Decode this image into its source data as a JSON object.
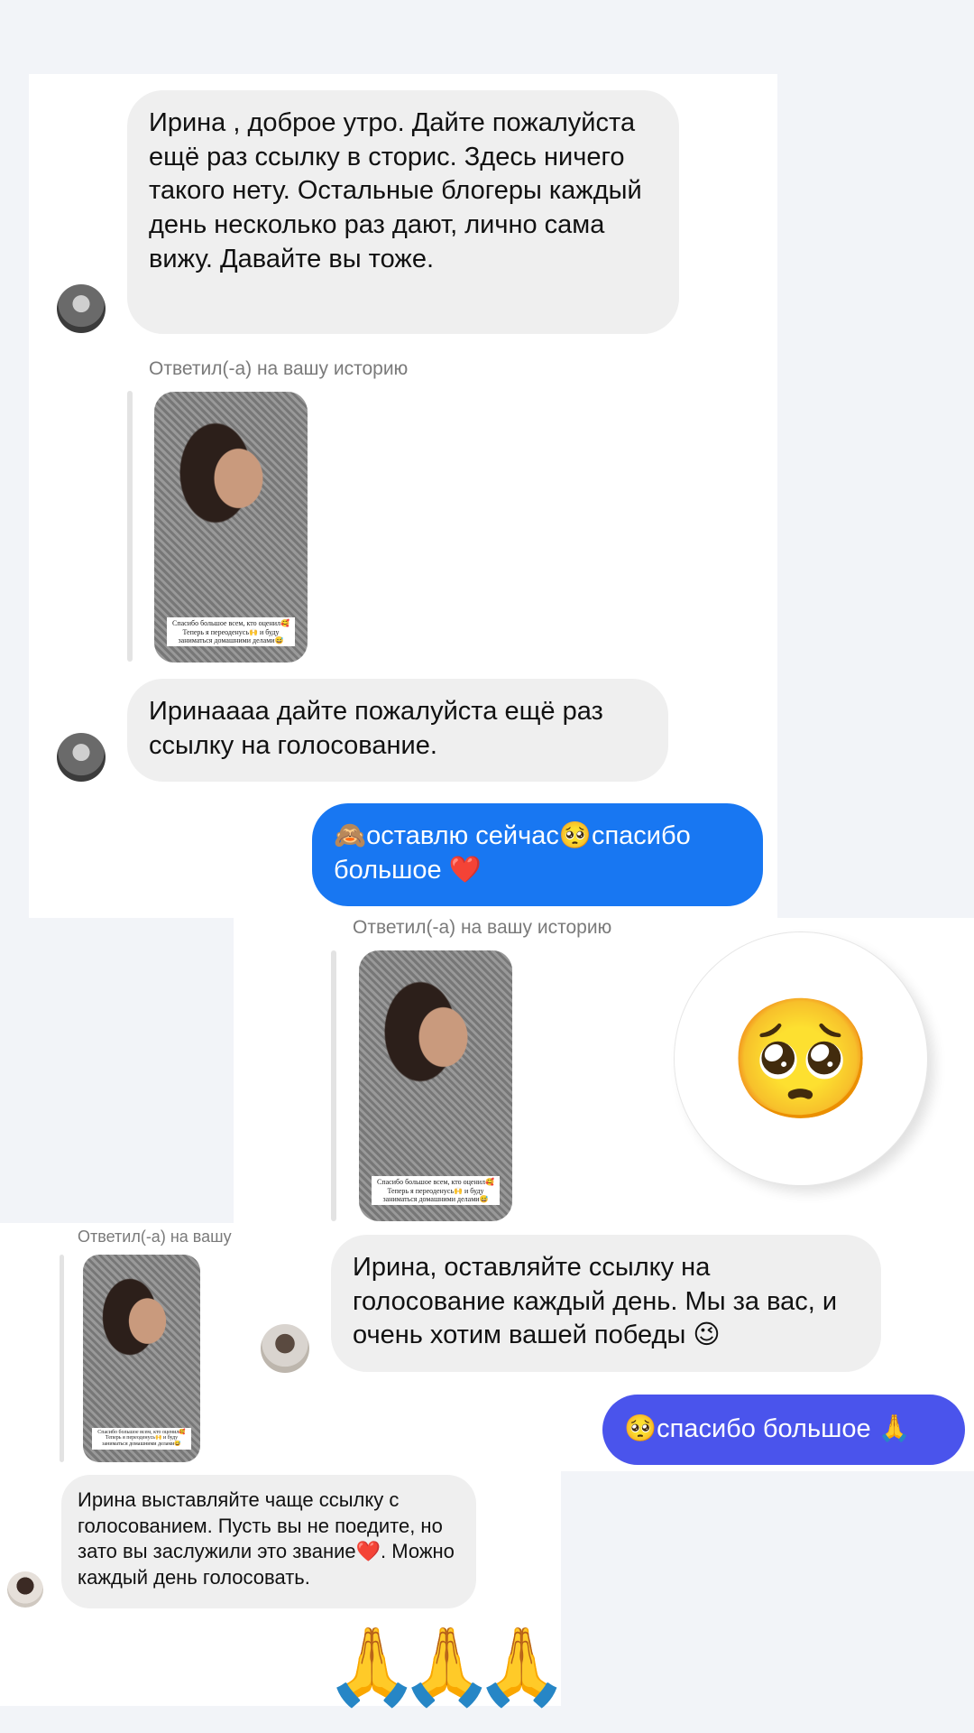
{
  "screenshot_1": {
    "message_1": "Ирина , доброе утро. Дайте пожалуйста ещё раз ссылку в сторис. Здесь ничего такого нету. Остальные блогеры каждый день несколько раз дают, лично сама вижу. Давайте вы тоже.",
    "reply_label": "Ответил(-а) на вашу историю",
    "story_caption": "Спасибо большое всем, кто оценил🥰 Теперь я переоденусь🙌 и буду заниматься домашними делами😅",
    "message_2": "Иринаааа дайте пожалуйста ещё раз ссылку на голосование.",
    "my_reply": "🙈оставлю сейчас🥺спасибо большое ❤️"
  },
  "screenshot_2": {
    "reply_label": "Ответил(-а) на вашу историю",
    "story_caption": "Спасибо большое всем, кто оценил🥰 Теперь я переоденусь🙌 и буду заниматься домашними делами😅",
    "emoji_reaction": "🥺",
    "message": "Ирина, оставляйте ссылку на голосование каждый день. Мы за вас, и очень хотим вашей победы 😉",
    "my_reply": "🥺спасибо большое 🙏"
  },
  "screenshot_3": {
    "reply_label": "Ответил(-а) на вашу историю",
    "story_caption": "Спасибо большое всем, кто оценил🥰 Теперь я переоденусь🙌 и буду заниматься домашними делами😅",
    "message": "Ирина выставляйте чаще ссылку с голосованием. Пусть вы не поедите, но зато вы заслужили это звание❤️. Можно каждый день голосовать.",
    "reaction_emojis": [
      "🙏",
      "🙏",
      "🙏"
    ]
  },
  "colors": {
    "incoming_bubble": "#efefef",
    "outgoing_blue": "#1877f2",
    "outgoing_indigo": "#4a54ec",
    "muted_text": "#7a7a7a"
  }
}
